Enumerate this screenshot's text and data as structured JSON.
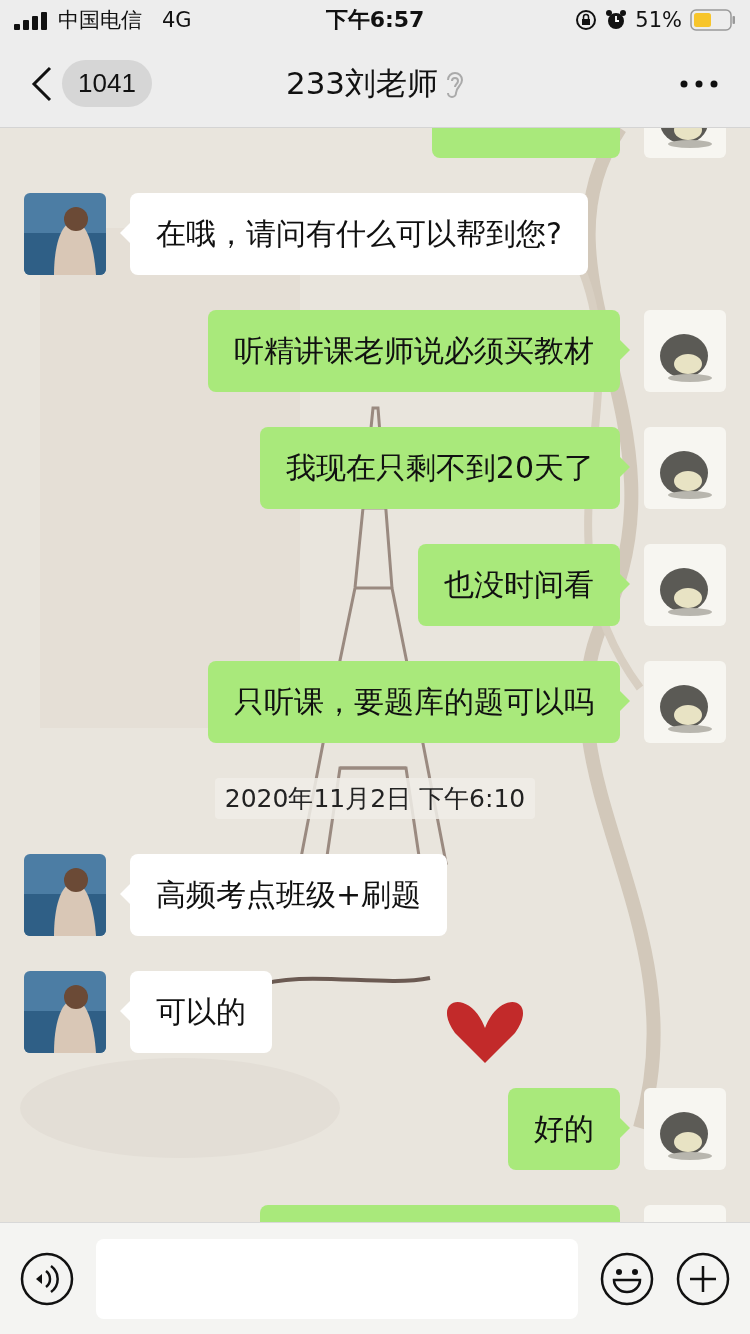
{
  "status_bar": {
    "carrier": "中国电信",
    "network": "4G",
    "time": "下午6:57",
    "battery_percent": "51%"
  },
  "nav": {
    "unread_count": "1041",
    "title": "233刘老师",
    "earpiece_mode": true
  },
  "messages": [
    {
      "kind": "sent_cut"
    },
    {
      "kind": "received",
      "text": "在哦，请问有什么可以帮到您?"
    },
    {
      "kind": "sent",
      "text": "听精讲课老师说必须买教材"
    },
    {
      "kind": "sent",
      "text": "我现在只剩不到20天了"
    },
    {
      "kind": "sent",
      "text": "也没时间看"
    },
    {
      "kind": "sent",
      "text": "只听课，要题库的题可以吗"
    },
    {
      "kind": "time",
      "text": "2020年11月2日 下午6:10"
    },
    {
      "kind": "received",
      "text": "高频考点班级+刷题"
    },
    {
      "kind": "received",
      "text": "可以的"
    },
    {
      "kind": "sent",
      "text": "好的"
    },
    {
      "kind": "sent_cut"
    }
  ]
}
